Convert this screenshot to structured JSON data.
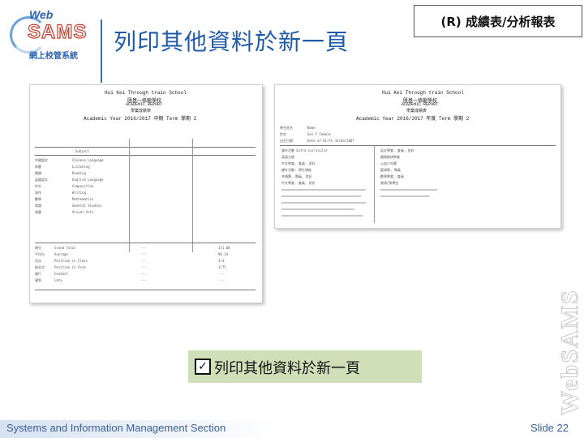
{
  "logo": {
    "web": "Web",
    "sams": "SAMS",
    "subtitle": "網上校管系統"
  },
  "title": "列印其他資料於新一頁",
  "section_badge": "(R) 成績表/分析報表",
  "report_left": {
    "school_en": "Hui Kei Through train School",
    "school_zh": "匯基一條龍學校",
    "report_en": "ACADEMIC REPORT",
    "report_zh": "學業成績表",
    "year": "Academic Year 2016/2017 中期 Term 學期 2",
    "col_subject": "Subject",
    "subjects": [
      {
        "zh": "中國語文",
        "en": "Chinese Language"
      },
      {
        "zh": "聆聽",
        "en": "Listening"
      },
      {
        "zh": "閱讀",
        "en": "Reading"
      },
      {
        "zh": "英國語文",
        "en": "English Language"
      },
      {
        "zh": "作文",
        "en": "Composition"
      },
      {
        "zh": "寫作",
        "en": "Writing"
      },
      {
        "zh": "數學",
        "en": "Mathematics"
      },
      {
        "zh": "常識",
        "en": "General Studies"
      },
      {
        "zh": "視藝",
        "en": "Visual Arts"
      }
    ],
    "totals": [
      {
        "zh": "總分",
        "en": "Grand Total"
      },
      {
        "zh": "平均分",
        "en": "Average"
      },
      {
        "zh": "名次",
        "en": "Position in Class"
      },
      {
        "zh": "級名次",
        "en": "Position in Form"
      },
      {
        "zh": "操行",
        "en": "Conduct"
      },
      {
        "zh": "遲到",
        "en": "Late"
      }
    ],
    "total_values": [
      "---",
      "---",
      "---",
      "---",
      "---",
      "---"
    ],
    "total_values2": [
      "171.00",
      "96.14",
      "3/4",
      "1/75",
      "---",
      "---"
    ]
  },
  "report_right": {
    "school_en": "Hui Kei Through train School",
    "school_zh": "匯基一條龍學校",
    "report_en": "ACADEMIC REPORT",
    "report_zh": "學業成績表",
    "year": "Academic Year 2016/2017 年度 Term 學期 2",
    "fields": [
      {
        "label": "學生姓名",
        "value": "Name"
      },
      {
        "label": "性別",
        "value": "Sex F Female"
      },
      {
        "label": "出生日期",
        "value": "Date of Birth 14/03/2007"
      }
    ],
    "items": [
      "課外活動 Extra-curricular",
      "英語大使",
      "中文學會, 會員, 良好",
      "課外活動: 學生領袖",
      "合唱團, 團員, 良好",
      "中文學會, 會員, 良好",
      "英文學會, 會員, 良好",
      "國際象棋學會",
      "公益少年團",
      "籃球隊, 隊員",
      "數學學會, 會員",
      "獎項/獎學金"
    ]
  },
  "option": {
    "checked": true,
    "mark": "✓",
    "label": "列印其他資料於新一頁"
  },
  "footer": {
    "department": "Systems and Information Management Section",
    "slide": "Slide 22"
  },
  "watermark": "WebSAMS"
}
